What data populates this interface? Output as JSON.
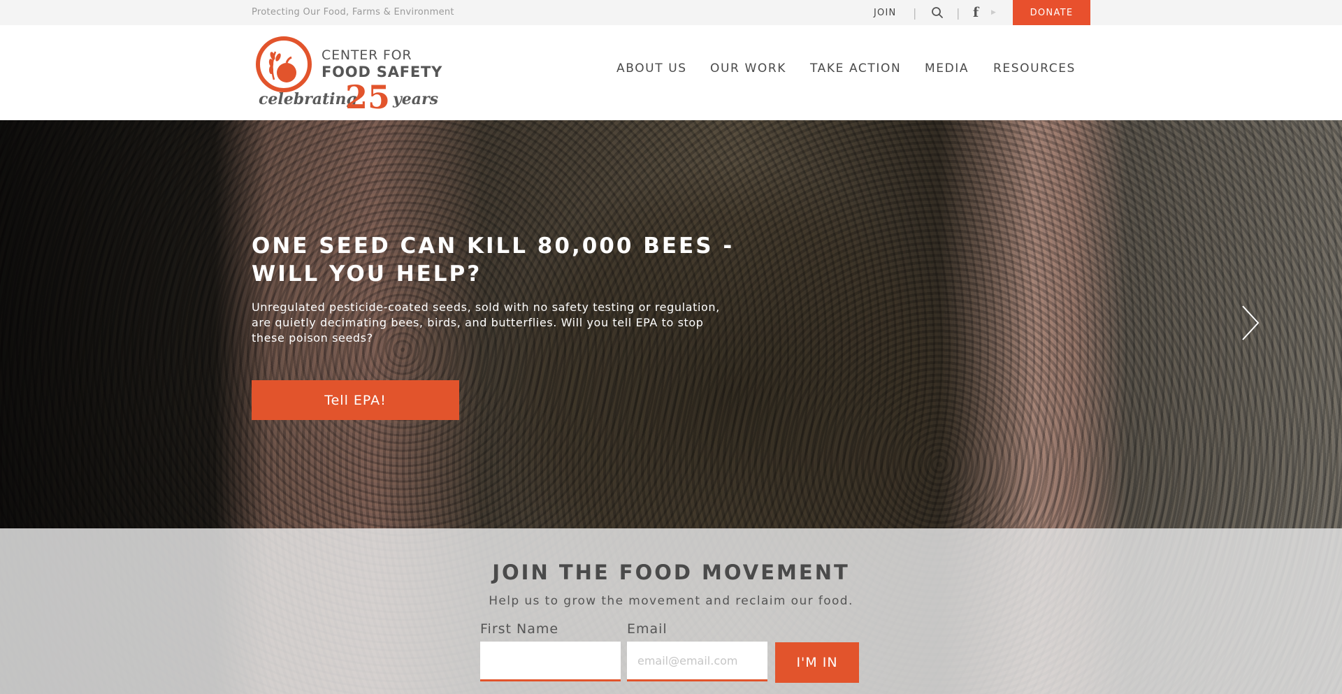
{
  "topbar": {
    "tagline": "Protecting Our Food, Farms & Environment",
    "join_label": "JOIN",
    "separator": "|",
    "donate_label": "DONATE"
  },
  "logo": {
    "line1": "CENTER FOR",
    "line2": "FOOD SAFETY",
    "celebrating": "celebrating",
    "number": "25",
    "years": "years"
  },
  "nav": {
    "items": [
      {
        "label": "ABOUT US"
      },
      {
        "label": "OUR WORK"
      },
      {
        "label": "TAKE ACTION"
      },
      {
        "label": "MEDIA"
      },
      {
        "label": "RESOURCES"
      }
    ]
  },
  "hero": {
    "title": "ONE SEED CAN KILL 80,000 BEES - WILL YOU HELP?",
    "description": "Unregulated pesticide-coated seeds, sold with no safety testing or regulation, are quietly decimating bees, birds, and butterflies. Will you tell EPA to stop these poison seeds?",
    "cta_label": "Tell EPA!"
  },
  "join": {
    "title": "JOIN THE FOOD MOVEMENT",
    "subtitle": "Help us to grow the movement and reclaim our food.",
    "first_name_label": "First Name",
    "first_name_value": "",
    "email_label": "Email",
    "email_placeholder": "email@email.com",
    "submit_label": "I'M IN"
  },
  "icons": {
    "search": "search-icon",
    "facebook": "facebook-icon",
    "next": "chevron-right-icon"
  },
  "colors": {
    "accent": "#e2542c",
    "topbar_bg": "#f4f4f4",
    "text_dark": "#4a4a4a"
  }
}
